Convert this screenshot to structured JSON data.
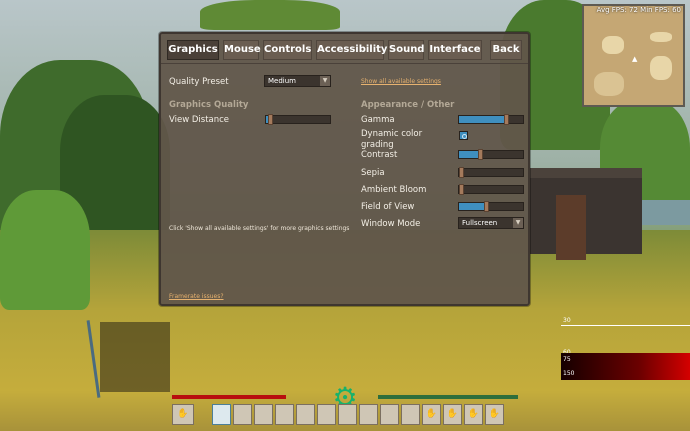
{
  "tabs": [
    {
      "label": "Graphics",
      "active": true
    },
    {
      "label": "Mouse",
      "active": false
    },
    {
      "label": "Controls",
      "active": false
    },
    {
      "label": "Accessibility",
      "active": false
    },
    {
      "label": "Sound",
      "active": false
    },
    {
      "label": "Interface",
      "active": false
    },
    {
      "label": "Back",
      "active": false
    }
  ],
  "quality_preset": {
    "label": "Quality Preset",
    "value": "Medium"
  },
  "show_all_link": "Show all available settings",
  "graphics_quality": {
    "heading": "Graphics Quality",
    "view_distance": {
      "label": "View Distance",
      "level": 0.03
    }
  },
  "hint": "Click 'Show all available settings' for more graphics settings",
  "framerate_link": "Framerate issues?",
  "appearance": {
    "heading": "Appearance / Other",
    "gamma": {
      "label": "Gamma",
      "level": 0.7
    },
    "dynamic_color_grading": {
      "label_line1": "Dynamic color",
      "label_line2": "grading",
      "checked": true
    },
    "contrast": {
      "label": "Contrast",
      "level": 0.3
    },
    "sepia": {
      "label": "Sepia",
      "level": 0.0
    },
    "ambient_bloom": {
      "label": "Ambient Bloom",
      "level": 0.0
    },
    "field_of_view": {
      "label": "Field of View",
      "level": 0.39
    },
    "window_mode": {
      "label": "Window Mode",
      "value": "Fullscreen"
    }
  },
  "minimap": {
    "fps_text": "Avg FPS: 72  Min FPS: 60"
  },
  "perf_graph": {
    "labels": [
      "30",
      "60",
      "75",
      "150"
    ]
  },
  "colors": {
    "accent_blue": "#3f8fbf",
    "panel": "#61564a",
    "link": "#e7b26f",
    "health": "#b80e0e",
    "gear": "#18b26b"
  },
  "icons": {
    "gear": "gear-icon",
    "dropdown": "chevron-down-icon"
  }
}
